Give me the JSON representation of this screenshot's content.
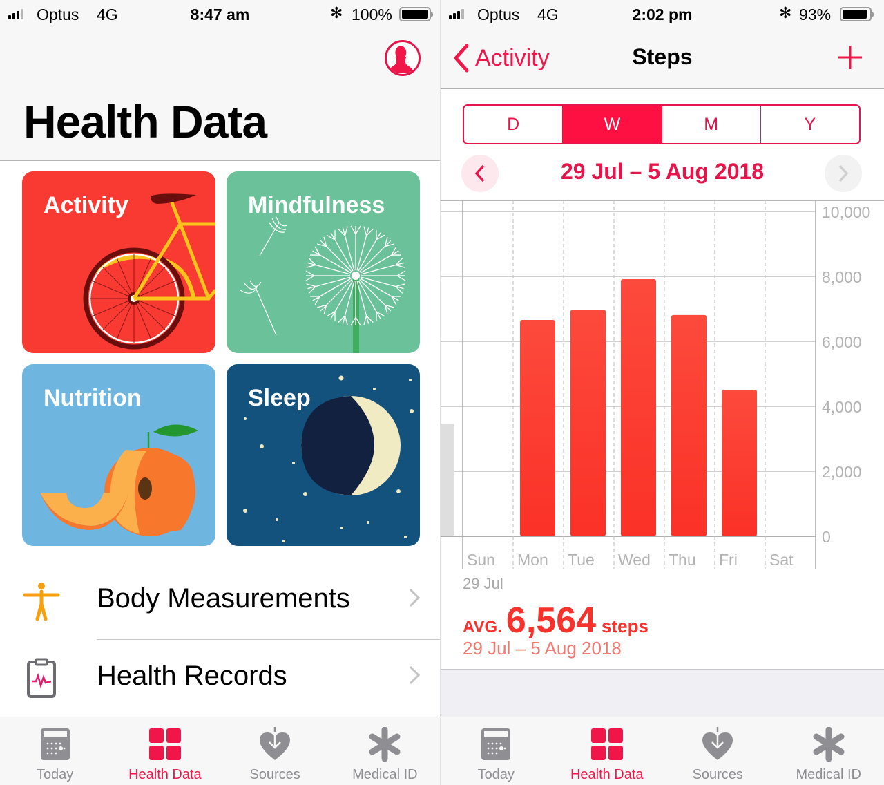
{
  "colors": {
    "accent": "#f0164a",
    "bar": "#fc3d33",
    "bar_prev": "#dedede",
    "grid": "#d0d0d0",
    "axis_text": "#b3b3b3",
    "tab_inactive": "#8e8e93"
  },
  "left": {
    "status": {
      "carrier": "Optus",
      "network": "4G",
      "time": "8:47 am",
      "bluetooth": "✻",
      "battery": "100%",
      "battery_fraction": 1.0
    },
    "profile_icon": "person-circle-icon",
    "title": "Health Data",
    "tiles": [
      {
        "label": "Activity",
        "icon": "bicycle-illustration",
        "color": "#f93a33"
      },
      {
        "label": "Mindfulness",
        "icon": "dandelion-illustration",
        "color": "#6bc19a"
      },
      {
        "label": "Nutrition",
        "icon": "peach-illustration",
        "color": "#6eb6e0"
      },
      {
        "label": "Sleep",
        "icon": "moon-illustration",
        "color": "#13527d"
      }
    ],
    "rows": [
      {
        "label": "Body Measurements",
        "icon": "body-figure-icon"
      },
      {
        "label": "Health Records",
        "icon": "clipboard-heartbeat-icon"
      }
    ]
  },
  "right": {
    "status": {
      "carrier": "Optus",
      "network": "4G",
      "time": "2:02 pm",
      "bluetooth": "✻",
      "battery": "93%",
      "battery_fraction": 0.93
    },
    "nav": {
      "back_label": "Activity",
      "title": "Steps",
      "add_icon": "plus-icon"
    },
    "segments": [
      {
        "label": "D",
        "active": false
      },
      {
        "label": "W",
        "active": true
      },
      {
        "label": "M",
        "active": false
      },
      {
        "label": "Y",
        "active": false
      }
    ],
    "range_title": "29 Jul – 5 Aug 2018",
    "range_start_label": "29 Jul",
    "summary": {
      "avg_label": "AVG.",
      "avg_value": "6,564",
      "unit": "steps",
      "range": "29 Jul – 5 Aug 2018"
    }
  },
  "tabbar": [
    {
      "label": "Today",
      "icon": "calendar-icon",
      "active": false
    },
    {
      "label": "Health Data",
      "icon": "grid-icon",
      "active": true
    },
    {
      "label": "Sources",
      "icon": "heart-download-icon",
      "active": false
    },
    {
      "label": "Medical ID",
      "icon": "asterisk-icon",
      "active": false
    }
  ],
  "chart_data": {
    "type": "bar",
    "title": "Steps",
    "categories": [
      "Sun",
      "Mon",
      "Tue",
      "Wed",
      "Thu",
      "Fri",
      "Sat"
    ],
    "values": [
      0,
      6660,
      6980,
      7915,
      6810,
      4510,
      0
    ],
    "previous_period_last_value": 3470,
    "xlabel": "",
    "ylabel": "",
    "ylim": [
      0,
      10000
    ],
    "yticks": [
      0,
      2000,
      4000,
      6000,
      8000,
      10000
    ],
    "ytick_labels": [
      "0",
      "2,000",
      "4,000",
      "6,000",
      "8,000",
      "10,000"
    ],
    "grid": true,
    "y_axis_side": "right"
  }
}
